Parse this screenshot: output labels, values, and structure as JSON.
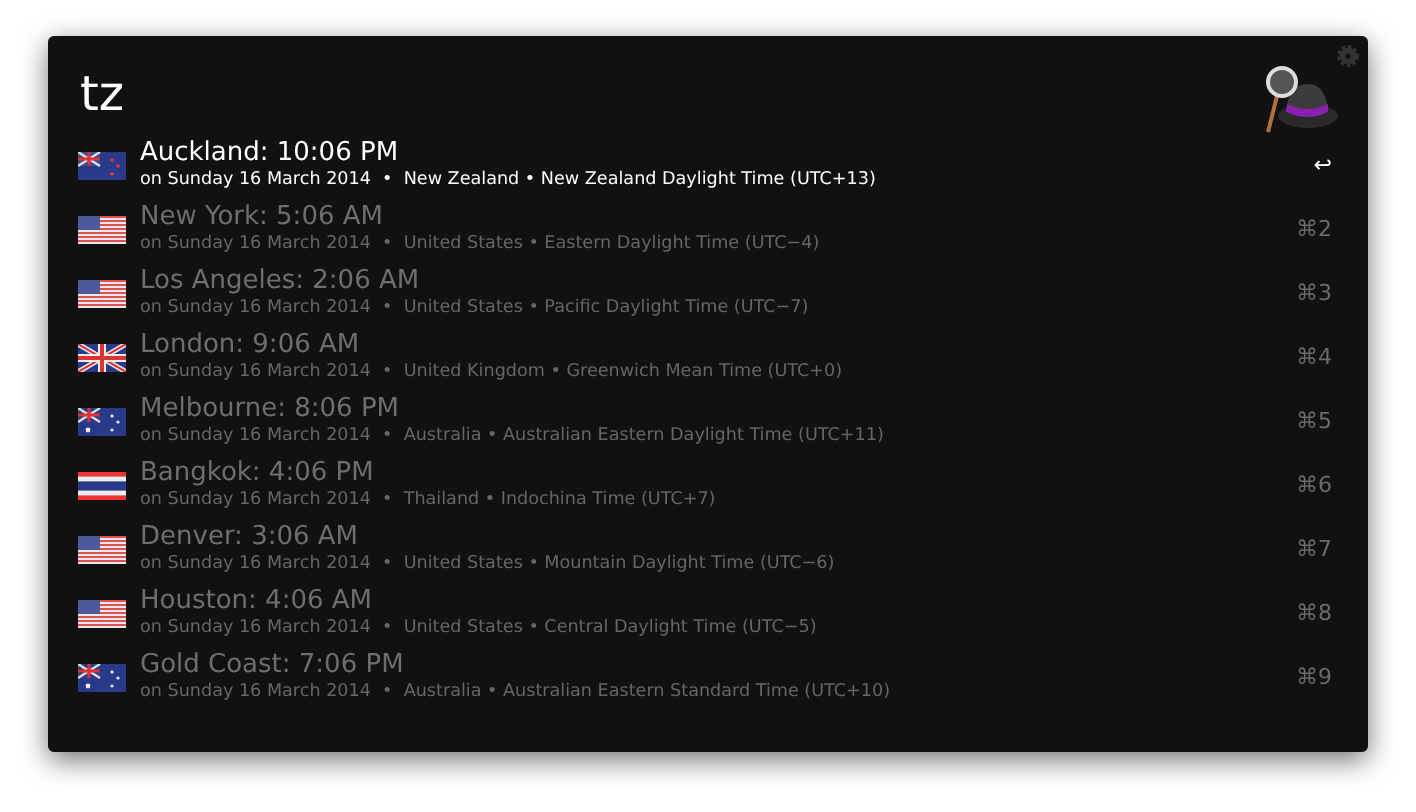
{
  "query": "tz",
  "results": [
    {
      "kind": "nz",
      "title": "Auckland: 10:06 PM",
      "subtitle": "on Sunday 16 March 2014  •  New Zealand • New Zealand Daylight Time (UTC+13)",
      "shortcut": "↩",
      "selected": true
    },
    {
      "kind": "us",
      "title": "New York: 5:06 AM",
      "subtitle": "on Sunday 16 March 2014  •  United States • Eastern Daylight Time (UTC−4)",
      "shortcut": "⌘2",
      "selected": false
    },
    {
      "kind": "us",
      "title": "Los Angeles: 2:06 AM",
      "subtitle": "on Sunday 16 March 2014  •  United States • Pacific Daylight Time (UTC−7)",
      "shortcut": "⌘3",
      "selected": false
    },
    {
      "kind": "gb",
      "title": "London: 9:06 AM",
      "subtitle": "on Sunday 16 March 2014  •  United Kingdom • Greenwich Mean Time (UTC+0)",
      "shortcut": "⌘4",
      "selected": false
    },
    {
      "kind": "au",
      "title": "Melbourne: 8:06 PM",
      "subtitle": "on Sunday 16 March 2014  •  Australia • Australian Eastern Daylight Time (UTC+11)",
      "shortcut": "⌘5",
      "selected": false
    },
    {
      "kind": "th",
      "title": "Bangkok: 4:06 PM",
      "subtitle": "on Sunday 16 March 2014  •  Thailand • Indochina Time (UTC+7)",
      "shortcut": "⌘6",
      "selected": false
    },
    {
      "kind": "us",
      "title": "Denver: 3:06 AM",
      "subtitle": "on Sunday 16 March 2014  •  United States • Mountain Daylight Time (UTC−6)",
      "shortcut": "⌘7",
      "selected": false
    },
    {
      "kind": "us",
      "title": "Houston: 4:06 AM",
      "subtitle": "on Sunday 16 March 2014  •  United States • Central Daylight Time (UTC−5)",
      "shortcut": "⌘8",
      "selected": false
    },
    {
      "kind": "au",
      "title": "Gold Coast: 7:06 PM",
      "subtitle": "on Sunday 16 March 2014  •  Australia • Australian Eastern Standard Time (UTC+10)",
      "shortcut": "⌘9",
      "selected": false
    }
  ]
}
